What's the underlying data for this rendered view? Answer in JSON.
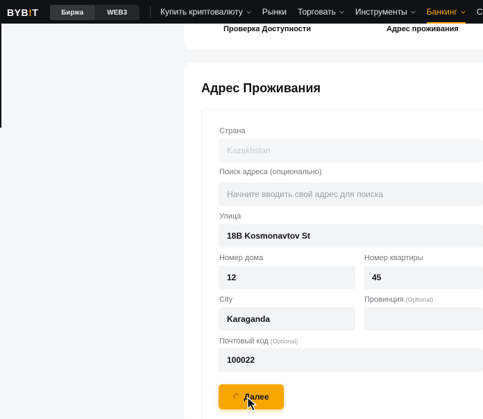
{
  "header": {
    "logo_text": "BYB",
    "logo_bang": "!",
    "logo_tail": "T",
    "switch": [
      "Биржа",
      "WEB3"
    ],
    "nav": [
      {
        "label": "Купить криптовалюту",
        "chevron": true
      },
      {
        "label": "Рынки",
        "chevron": false
      },
      {
        "label": "Торговать",
        "chevron": true
      },
      {
        "label": "Инструменты",
        "chevron": true
      },
      {
        "label": "Банкинг",
        "chevron": true,
        "active": true
      },
      {
        "label": "Card",
        "chevron": false
      }
    ],
    "accent_color": "#f7a600"
  },
  "steps": {
    "step1": "Проверка Доступности",
    "step2": "Адрес проживания"
  },
  "form": {
    "title": "Адрес Проживания",
    "country": {
      "label": "Страна",
      "value": "Kazakhstan"
    },
    "search": {
      "label": "Поиск адреса (опционально)",
      "placeholder": "Начните вводить свой адрес для поиска"
    },
    "street": {
      "label": "Улица",
      "value": "18B Kosmonavtov St"
    },
    "house": {
      "label": "Номер дома",
      "value": "12"
    },
    "apartment": {
      "label": "Номер квартиры",
      "value": "45"
    },
    "city": {
      "label": "City",
      "value": "Karaganda"
    },
    "province": {
      "label": "Провинция",
      "optional": "(Optional)",
      "value": ""
    },
    "postal": {
      "label": "Почтовый код",
      "optional": "(Optional)",
      "value": "100022"
    },
    "submit_label": "Далее"
  }
}
